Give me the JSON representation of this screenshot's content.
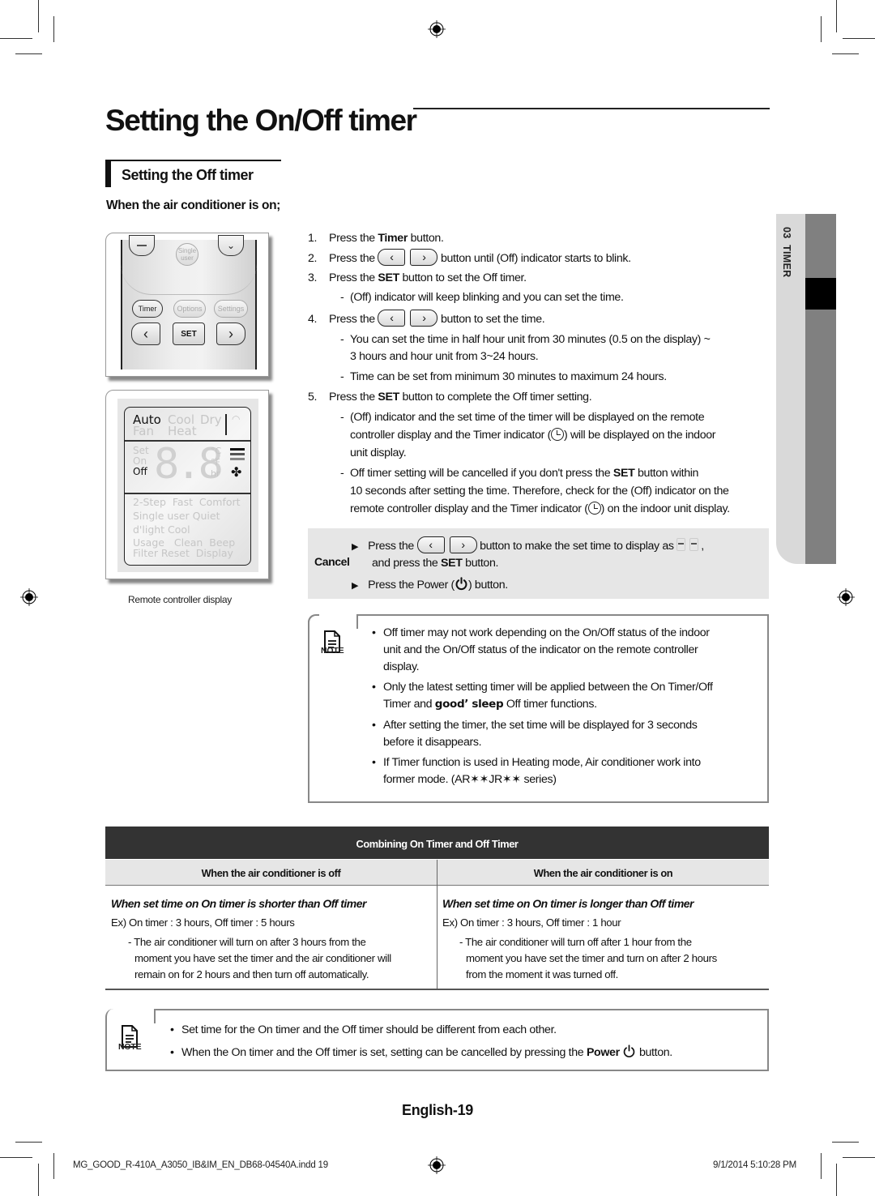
{
  "heading": {
    "title": "Setting the On/Off timer",
    "section": "Setting the Off timer",
    "condition": "When the air conditioner is on;"
  },
  "remote": {
    "buttons": {
      "single_user_line1": "Single",
      "single_user_line2": "user",
      "timer": "Timer",
      "options": "Options",
      "settings": "Settings",
      "left": "‹",
      "set": "SET",
      "right": "›"
    },
    "display": {
      "modes_row1": [
        "Auto",
        "Cool",
        "Dry"
      ],
      "modes_row2": [
        "Fan",
        "Heat"
      ],
      "timer_labels": [
        "Set",
        "On",
        "Off"
      ],
      "units": [
        "°C",
        "°F",
        "hr"
      ],
      "digits": "8.8",
      "options_rows": [
        [
          "2-Step",
          "Fast",
          "Comfort"
        ],
        [
          "Single user",
          "Quiet"
        ],
        [
          "d'light Cool"
        ],
        [
          "Usage",
          "Clean",
          "Beep"
        ],
        [
          "Filter Reset",
          "Display"
        ]
      ],
      "active": [
        "Auto",
        "Off"
      ]
    },
    "caption": "Remote controller display"
  },
  "steps": [
    {
      "num": "1.",
      "pre": "Press the ",
      "bold": "Timer",
      "post": " button."
    },
    {
      "num": "2.",
      "pre": "Press the ",
      "post": " button until (Off) indicator starts to blink."
    },
    {
      "num": "3.",
      "pre": "Press the ",
      "bold": "SET",
      "post": " button to set the Off timer."
    },
    {
      "num": "4.",
      "pre": "Press the ",
      "post": " button to set the time."
    },
    {
      "num": "5.",
      "pre": "Press the ",
      "bold": "SET",
      "post": " button to complete the Off timer setting."
    }
  ],
  "step_subs": {
    "s3a": "(Off) indicator will keep blinking and you can set the time.",
    "s4a_line1": "You can set the time in half hour unit from 30 minutes (0.5 on the display) ~",
    "s4a_line2": "3 hours and hour unit from 3~24 hours.",
    "s4b": "Time can be set from minimum 30 minutes to maximum 24 hours.",
    "s5a_line1": "(Off) indicator and the set time of the timer will be displayed on the remote",
    "s5a_line2_pre": "controller display and the Timer indicator (",
    "s5a_line2_post": ") will be displayed on the indoor",
    "s5a_line3": "unit display.",
    "s5b_line1_pre": "Off timer setting will be cancelled if you don't press the ",
    "s5b_line1_bold": "SET",
    "s5b_line1_post": " button within",
    "s5b_line2": "10 seconds after setting the time. Therefore, check for the (Off) indicator on the",
    "s5b_line3_pre": "remote controller display and the Timer indicator (",
    "s5b_line3_post": ") on the indoor unit display.",
    "dash": "-"
  },
  "side_tab": {
    "chapter": "03",
    "label": "TIMER"
  },
  "cancel": {
    "label": "Cancel",
    "row1_pre": "Press the ",
    "row1_post": " button to make the set time to display as ",
    "row1_end": ",",
    "row2_pre": "and press the ",
    "row2_bold": "SET",
    "row2_post": " button.",
    "row3_pre": "Press the Power (",
    "row3_post": ") button.",
    "bullet": "▶"
  },
  "note1": {
    "label": "NOTE",
    "items": [
      [
        "Off timer may not work depending on the On/Off status of the indoor",
        "unit and the On/Off status of the indicator on the remote controller",
        "display."
      ],
      [
        "Only the latest setting timer will be applied between the On Timer/Off"
      ],
      [
        "After setting the timer, the set time will be displayed for 3 seconds",
        "before it disappears."
      ],
      [
        "If Timer function is used in Heating mode, Air conditioner work into",
        "former mode. (AR✶✶JR✶✶ series)"
      ]
    ],
    "item2_line2_pre": "Timer and ",
    "item2_line2_bold": "good’ sleep",
    "item2_line2_post": " Off timer functions.",
    "dot": "•"
  },
  "table": {
    "title": "Combining On Timer and Off Timer",
    "columns": [
      "When the air conditioner is off",
      "When the air conditioner is on"
    ],
    "rows": [
      {
        "title": "When set time on On timer is shorter than Off timer",
        "example": "Ex) On timer : 3 hours, Off timer : 5 hours",
        "desc": [
          "- The air conditioner will turn on after 3 hours from the",
          "moment you have set the timer and the air conditioner will",
          "remain on for 2 hours and then turn off automatically."
        ]
      },
      {
        "title": "When set time on On timer is longer than Off timer",
        "example": "Ex) On timer : 3 hours, Off timer : 1 hour",
        "desc": [
          "- The air conditioner will turn off after 1 hour from the",
          "moment you have set the timer and turn on after 2 hours",
          "from the moment it was turned off."
        ]
      }
    ]
  },
  "note2": {
    "label": "NOTE",
    "item1": "Set time for the On timer and the Off timer should be different from each other.",
    "item2_pre": "When the On timer and the Off timer is set, setting can be cancelled by pressing the ",
    "item2_bold": "Power",
    "item2_post": " button.",
    "dot": "•"
  },
  "page_number": "English-19",
  "footer": {
    "file": "MG_GOOD_R-410A_A3050_IB&IM_EN_DB68-04540A.indd   19",
    "timestamp": "9/1/2014   5:10:28 PM"
  }
}
